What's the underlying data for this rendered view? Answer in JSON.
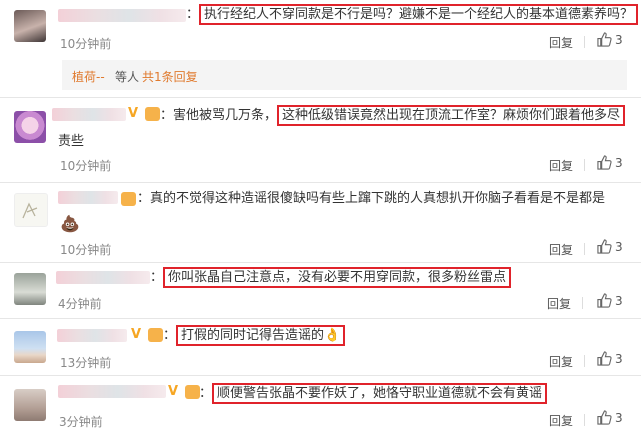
{
  "actions": {
    "reply_label": "回复"
  },
  "comments": [
    {
      "text_pre": "",
      "text_hl": "执行经纪人不穿同款是不行是吗？避嫌不是一个经纪人的基本道德素养吗？",
      "text_post": "",
      "time": "10分钟前",
      "likes": "3"
    },
    {
      "text_pre": "害他被骂几万条，",
      "text_hl": "这种低级错误竟然出现在顶流工作室？麻烦你们跟着他多尽",
      "text_post": "责些",
      "time": "10分钟前",
      "likes": "3"
    },
    {
      "text_pre": "真的不觉得这种造谣很傻缺吗有些上蹿下跳的人真想扒开你脑子看看是不是都是",
      "text_hl": "",
      "text_post": "",
      "emoji": "poop",
      "time": "10分钟前",
      "likes": "3"
    },
    {
      "text_pre": "",
      "text_hl": "你叫张晶自己注意点，没有必要不用穿同款，很多粉丝雷点",
      "text_post": "",
      "time": "4分钟前",
      "likes": "3"
    },
    {
      "text_pre": "",
      "text_hl": "打假的同时记得告造谣的",
      "text_post": "",
      "emoji": "ok-hand",
      "time": "13分钟前",
      "likes": "3"
    },
    {
      "text_pre": "",
      "text_hl": "顺便警告张晶不要作妖了，她恪守职业道德就不会有黄谣",
      "text_post": "",
      "time": "3分钟前",
      "likes": "3"
    }
  ],
  "subreply": {
    "name": "植荷--",
    "suffix": "等人",
    "count_label": "共1条回复"
  },
  "colors": {
    "highlight_border": "#e0232b",
    "subreply_name": "#e07a2e",
    "time": "#888888"
  },
  "icons": [
    "thumbs-up-icon",
    "vip-v-icon",
    "level-badge-icon",
    "poop-emoji",
    "ok-hand-emoji"
  ]
}
